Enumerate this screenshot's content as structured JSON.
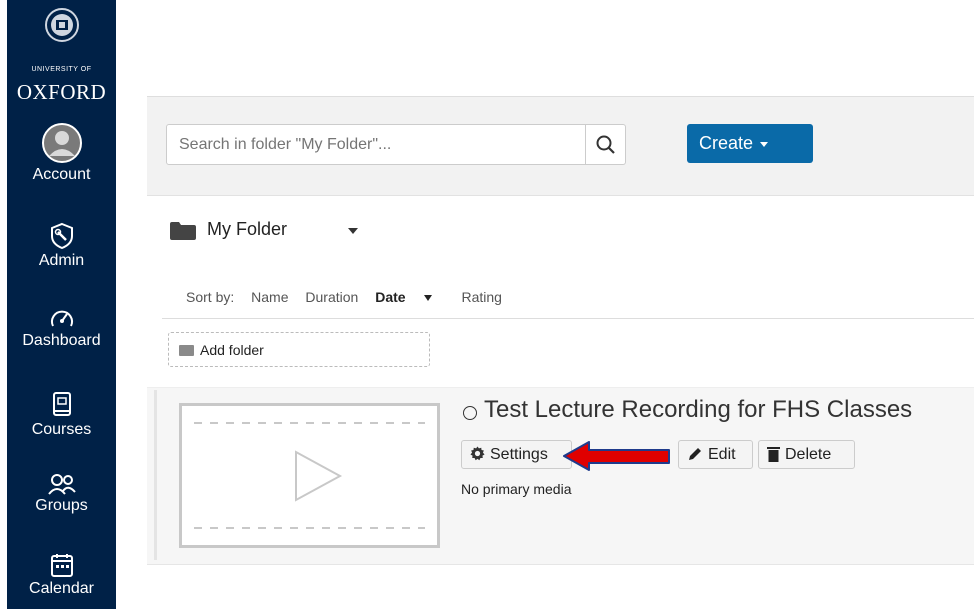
{
  "sidebar": {
    "logo_top": "UNIVERSITY OF",
    "logo_main": "OXFORD",
    "items": [
      {
        "label": "Account",
        "icon": "account-icon"
      },
      {
        "label": "Admin",
        "icon": "admin-icon"
      },
      {
        "label": "Dashboard",
        "icon": "dashboard-icon"
      },
      {
        "label": "Courses",
        "icon": "courses-icon"
      },
      {
        "label": "Groups",
        "icon": "groups-icon"
      },
      {
        "label": "Calendar",
        "icon": "calendar-icon"
      }
    ]
  },
  "toolbar": {
    "search_placeholder": "Search in folder \"My Folder\"...",
    "create_label": "Create"
  },
  "folder": {
    "name": "My Folder",
    "sort_by_label": "Sort by:",
    "sort_options": [
      "Name",
      "Duration",
      "Date",
      "Rating"
    ],
    "active_sort": "Date",
    "add_folder_label": "Add folder"
  },
  "media": {
    "title": "Test Lecture Recording for FHS Classes",
    "settings_label": "Settings",
    "edit_label": "Edit",
    "delete_label": "Delete",
    "status_text": "No primary media"
  },
  "colors": {
    "nav_bg": "#002147",
    "create_bg": "#0a6aa8",
    "annotation_arrow": "#e00000"
  }
}
